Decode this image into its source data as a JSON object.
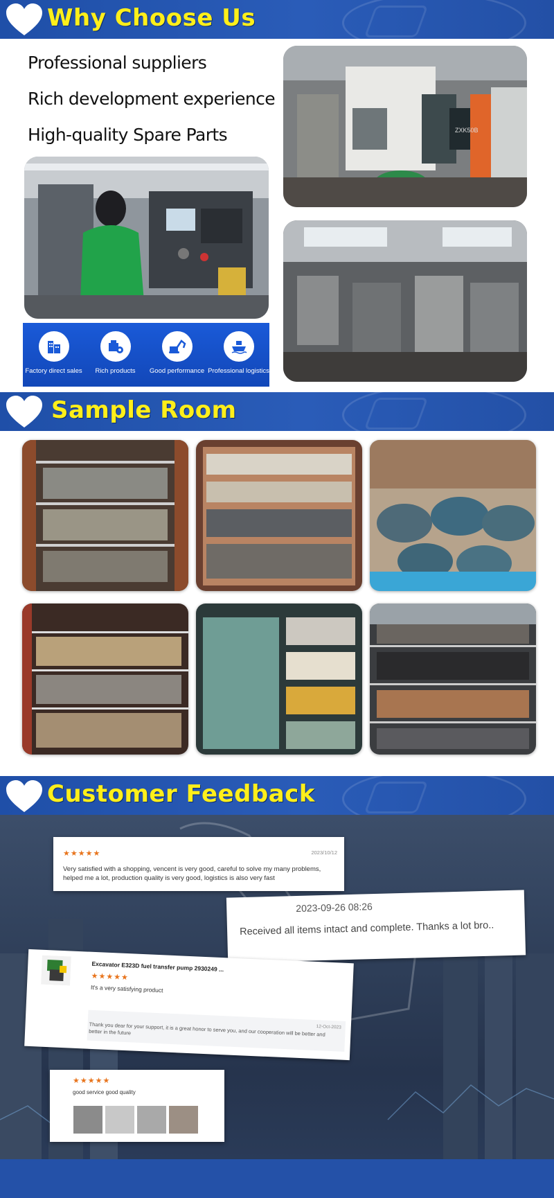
{
  "sections": {
    "why": {
      "title": "Why Choose Us"
    },
    "sample": {
      "title": "Sample Room"
    },
    "feedback": {
      "title": "Customer Feedback"
    }
  },
  "why_choose_us": {
    "features": [
      "Professional suppliers",
      "Rich development experience",
      "High-quality Spare Parts"
    ],
    "services": [
      {
        "label": "Factory direct sales",
        "icon": "building-icon"
      },
      {
        "label": "Rich products",
        "icon": "products-icon"
      },
      {
        "label": "Good performance",
        "icon": "excavator-icon"
      },
      {
        "label": "Professional logistics",
        "icon": "ship-icon"
      }
    ],
    "machine_plate": "ZXK50B"
  },
  "reviews": [
    {
      "stars": "★★★★★",
      "date": "2023/10/12",
      "text": "Very satisfied with a shopping, vencent is very good, careful to solve my many problems, helped me a lot, production quality is very good, logistics is also very fast"
    },
    {
      "date": "2023-09-26 08:26",
      "text": "Received all items intact and complete. Thanks a lot bro.."
    },
    {
      "product": "Excavator E323D fuel transfer pump 2930249 ...",
      "stars": "★★★★★",
      "text": "It's a very satisfying product",
      "reply": "Thank you dear for your support, it is a great honor to serve you, and our cooperation will be better and better in the future",
      "reply_date": "12-Oct-2023"
    },
    {
      "stars": "★★★★★",
      "text": "good service good quality"
    }
  ],
  "colors": {
    "banner": "#2451a8",
    "title_yellow": "#ffef1a",
    "star_orange": "#e8741c"
  }
}
